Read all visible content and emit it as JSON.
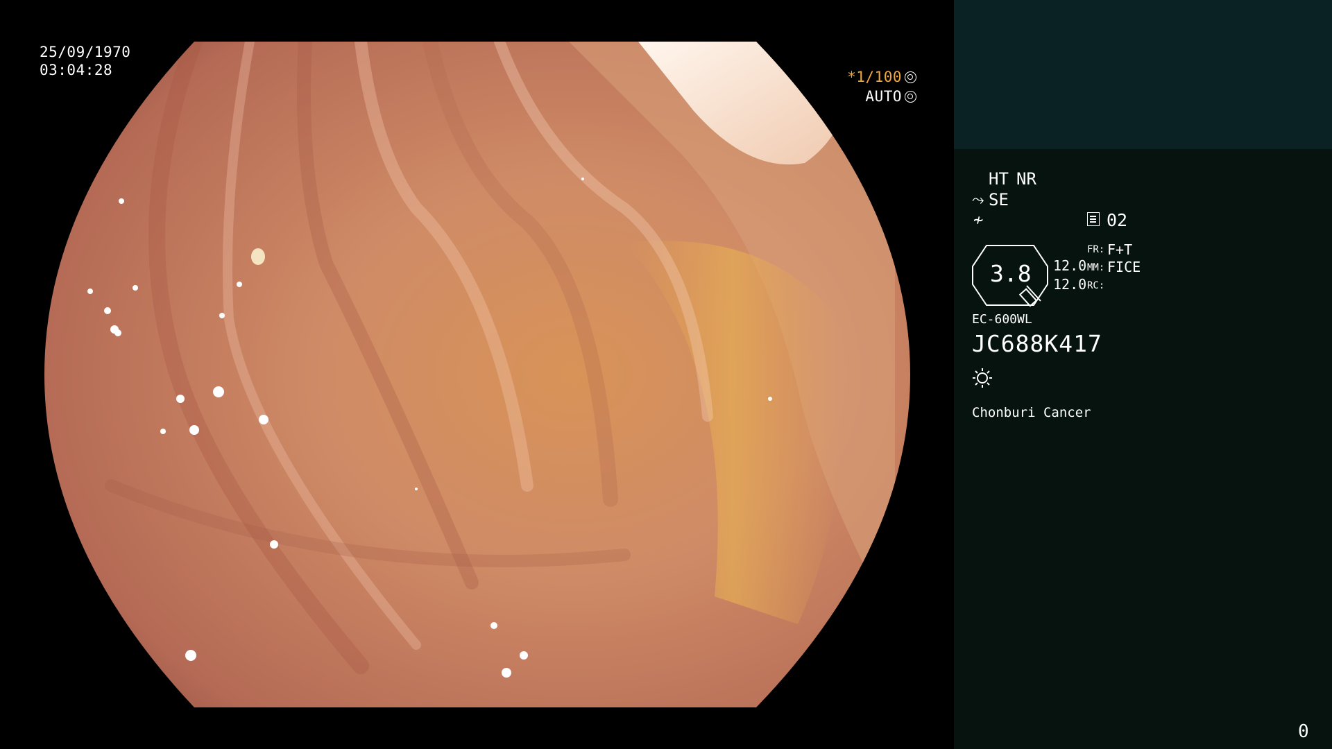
{
  "overlay": {
    "date": "25/09/1970",
    "time": "03:04:28",
    "shutter": "*1/100",
    "iris": "AUTO"
  },
  "panel": {
    "ht": "HT",
    "nr": "NR",
    "se": "SE",
    "memo": "02",
    "zoom": "3.8",
    "value_1": "12.0",
    "value_2": "12.0",
    "fr_label": "FR:",
    "fr_value": "F+T",
    "mm_label": "MM:",
    "mm_value": "FICE",
    "rc_label": "RC:",
    "model": "EC-600WL",
    "serial": "JC688K417",
    "hospital": "Chonburi Cancer",
    "counter": "0"
  },
  "colors": {
    "accent_orange": "#f3a93a",
    "panel_top": "#0b2224",
    "panel_bottom": "#06130f",
    "mucosa": "#c9856a"
  },
  "icons": [
    "shutter-icon",
    "iris-icon",
    "scope-angle-icon",
    "freeze-icon",
    "memo-icon",
    "zoom-octagon-icon",
    "light-icon"
  ]
}
